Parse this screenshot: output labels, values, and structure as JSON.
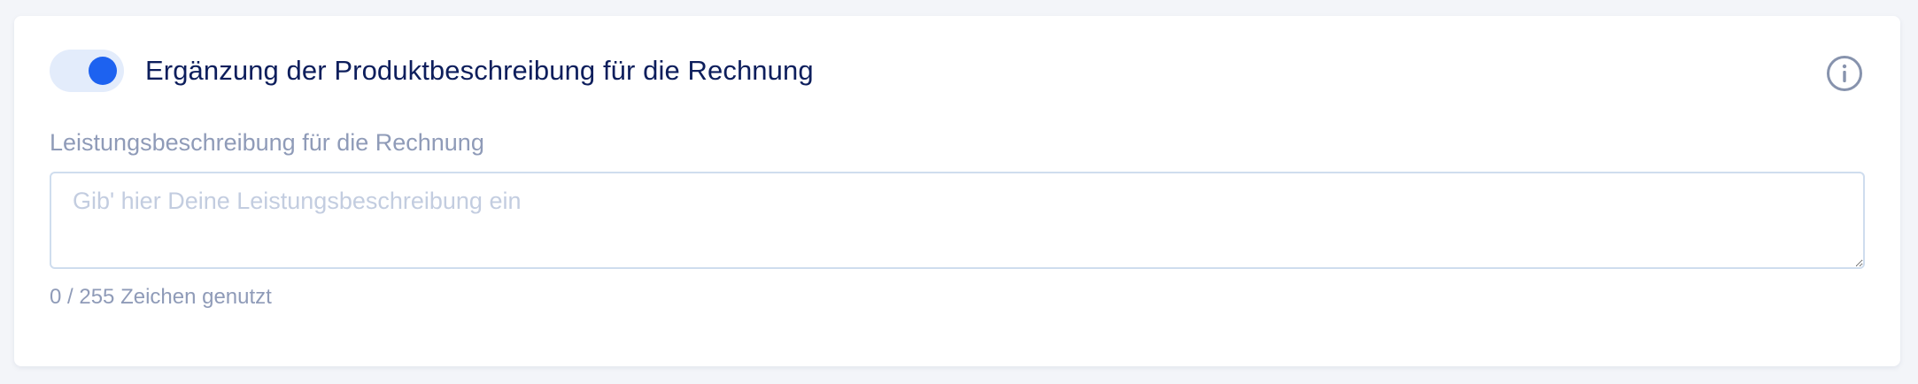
{
  "card": {
    "toggle": {
      "state": "on",
      "track_color": "#e3ecfb",
      "knob_color": "#1d62f0"
    },
    "title": "Ergänzung der Produktbeschreibung für die Rechnung",
    "info_icon": "info-circle-icon",
    "field": {
      "label": "Leistungsbeschreibung für die Rechnung",
      "value": "",
      "placeholder": "Gib' hier Deine Leistungsbeschreibung ein",
      "char_count": "0 / 255 Zeichen genutzt"
    }
  },
  "colors": {
    "background": "#f3f5f9",
    "title_text": "#0d1e5c",
    "muted_text": "#8f9bb8",
    "accent": "#1d62f0"
  }
}
